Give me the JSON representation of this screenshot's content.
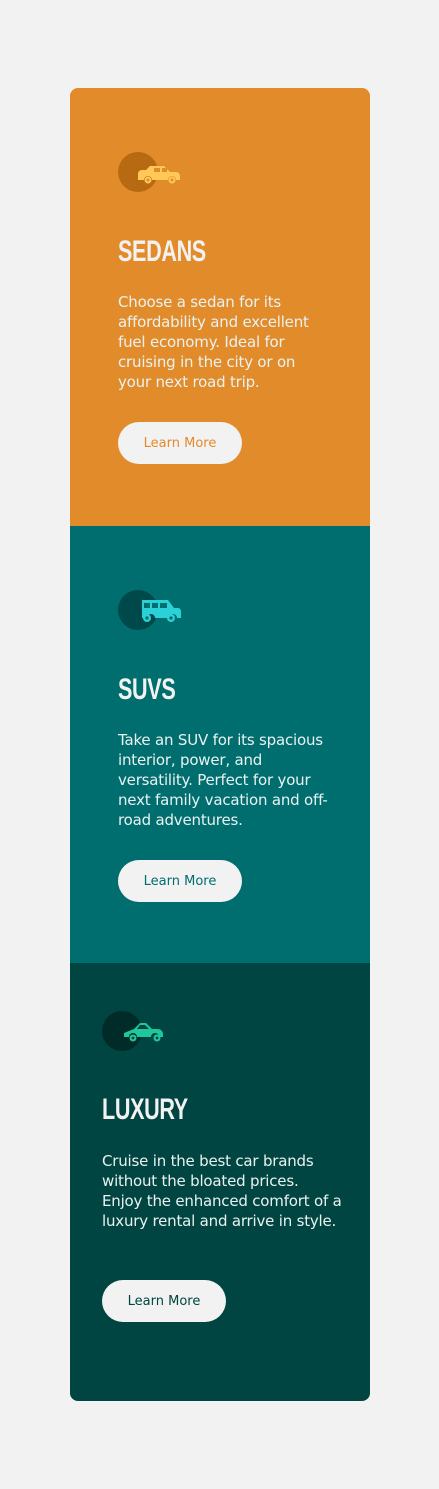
{
  "cards": [
    {
      "id": "sedans",
      "title": "Sedans",
      "description": "Choose a sedan for its affordability and excellent fuel economy. Ideal for cruising in the city or on your next road trip.",
      "button_label": "Learn More",
      "icon": "sedan-car-icon",
      "background": "#e28b2a"
    },
    {
      "id": "suvs",
      "title": "SUVs",
      "description": "Take an SUV for its spacious interior, power, and versatility. Perfect for your next family vacation and off-road adventures.",
      "button_label": "Learn More",
      "icon": "suv-car-icon",
      "background": "#006d6f"
    },
    {
      "id": "luxury",
      "title": "Luxury",
      "description": "Cruise in the best car brands without the bloated prices. Enjoy the enhanced comfort of a luxury rental and arrive in style.",
      "button_label": "Learn More",
      "icon": "luxury-car-icon",
      "background": "#004541"
    }
  ],
  "colors": {
    "page_background": "#f2f2f2",
    "orange": "#e28b2a",
    "teal": "#006d6f",
    "dark_teal": "#004541",
    "light": "#f2f2f2"
  }
}
